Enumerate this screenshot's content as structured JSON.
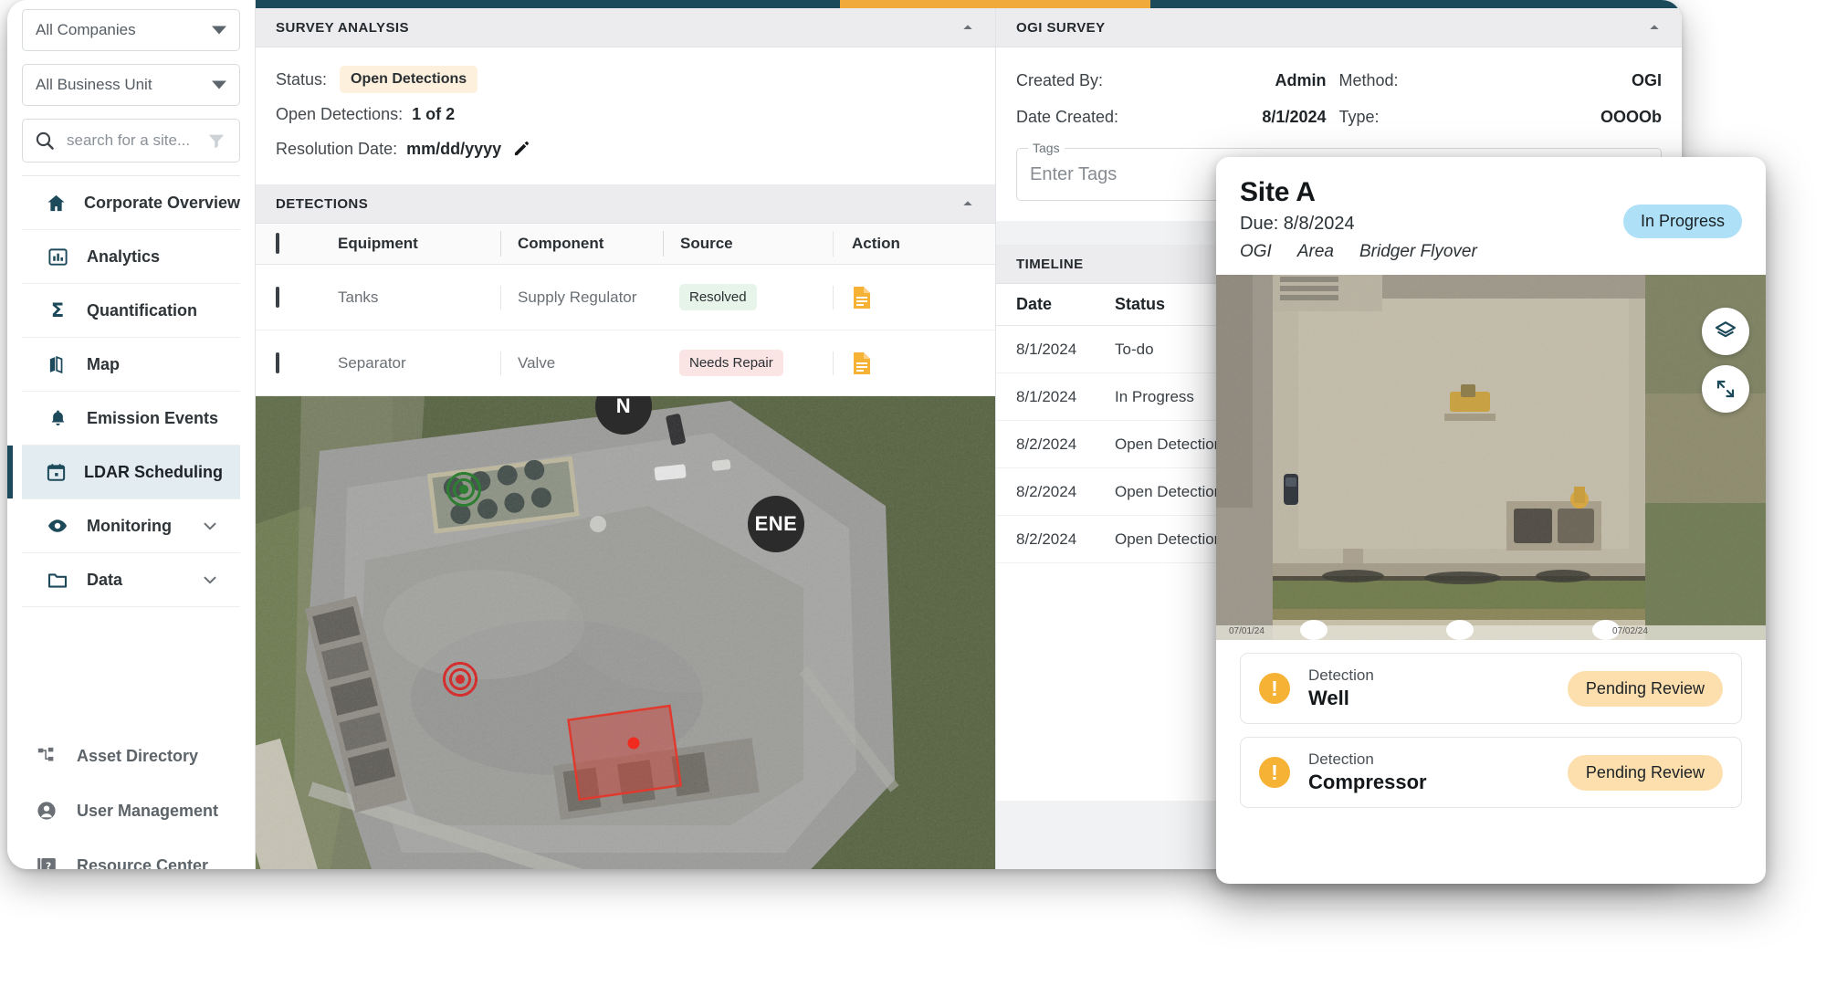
{
  "topbar": {
    "accent_dark": "#1d4a5b",
    "accent_orange": "#f0a93b"
  },
  "sidebar": {
    "company_filter": {
      "value": "All Companies",
      "icon": "chevron-down-icon"
    },
    "business_unit_filter": {
      "value": "All Business Unit",
      "icon": "chevron-down-icon"
    },
    "search": {
      "placeholder": "search for a site...",
      "icon": "search-icon",
      "filter_icon": "funnel-icon"
    },
    "items": [
      {
        "label": "Corporate Overview",
        "icon": "home-icon",
        "active": false,
        "expandable": false
      },
      {
        "label": "Analytics",
        "icon": "bar-chart-icon",
        "active": false,
        "expandable": false
      },
      {
        "label": "Quantification",
        "icon": "sigma-icon",
        "active": false,
        "expandable": false
      },
      {
        "label": "Map",
        "icon": "map-icon",
        "active": false,
        "expandable": false
      },
      {
        "label": "Emission Events",
        "icon": "bell-icon",
        "active": false,
        "expandable": false
      },
      {
        "label": "LDAR Scheduling",
        "icon": "calendar-icon",
        "active": true,
        "expandable": false
      },
      {
        "label": "Monitoring",
        "icon": "eye-icon",
        "active": false,
        "expandable": true
      },
      {
        "label": "Data",
        "icon": "folder-icon",
        "active": false,
        "expandable": true
      }
    ],
    "bottom_items": [
      {
        "label": "Asset Directory",
        "icon": "sitemap-icon"
      },
      {
        "label": "User Management",
        "icon": "user-circle-icon"
      },
      {
        "label": "Resource Center",
        "icon": "help-book-icon"
      }
    ]
  },
  "survey_analysis": {
    "title": "SURVEY ANALYSIS",
    "collapse_icon": "chevron-up-icon",
    "status_label": "Status:",
    "status_value": "Open Detections",
    "open_detections_label": "Open Detections:",
    "open_detections_value": "1 of 2",
    "resolution_label": "Resolution Date:",
    "resolution_value": "mm/dd/yyyy",
    "edit_icon": "pencil-icon"
  },
  "detections": {
    "title": "DETECTIONS",
    "collapse_icon": "chevron-up-icon",
    "columns": [
      "Equipment",
      "Component",
      "Source",
      "Action"
    ],
    "rows": [
      {
        "equipment": "Tanks",
        "component": "Supply Regulator",
        "source": "Resolved",
        "source_kind": "resolved",
        "action_icon": "document-note-icon"
      },
      {
        "equipment": "Separator",
        "component": "Valve",
        "source": "Needs Repair",
        "source_kind": "repair",
        "action_icon": "document-note-icon"
      }
    ]
  },
  "map": {
    "compass_markers": [
      {
        "label": "N"
      },
      {
        "label": "ENE"
      }
    ],
    "detection_markers": [
      {
        "kind": "green-target"
      },
      {
        "kind": "red-target"
      }
    ],
    "leak_polygon": {
      "color": "#e03a2f"
    }
  },
  "ogi_survey": {
    "title": "OGI SURVEY",
    "collapse_icon": "chevron-up-icon",
    "fields": [
      {
        "key": "Created By:",
        "value": "Admin"
      },
      {
        "key": "Method:",
        "value": "OGI"
      },
      {
        "key": "Date Created:",
        "value": "8/1/2024"
      },
      {
        "key": "Type:",
        "value": "OOOOb"
      }
    ],
    "tags": {
      "legend": "Tags",
      "placeholder": "Enter Tags"
    }
  },
  "timeline": {
    "title": "TIMELINE",
    "columns": [
      "Date",
      "Status"
    ],
    "rows": [
      {
        "date": "8/1/2024",
        "status": "In Progress"
      },
      {
        "date": "8/1/2024",
        "status": "To-do"
      },
      {
        "date": "8/1/2024",
        "status": "In Progress"
      },
      {
        "date": "8/2/2024",
        "status": "Open Detections"
      },
      {
        "date": "8/2/2024",
        "status": "Open Detections"
      },
      {
        "date": "8/2/2024",
        "status": "Open Detections"
      }
    ]
  },
  "site_card": {
    "title": "Site A",
    "due": "Due: 8/8/2024",
    "badge": "In Progress",
    "meta": [
      "OGI",
      "Area",
      "Bridger Flyover"
    ],
    "layers_icon": "layers-icon",
    "expand_icon": "expand-icon",
    "detections": [
      {
        "sub": "Detection",
        "name": "Well",
        "status": "Pending Review",
        "icon": "alert-icon"
      },
      {
        "sub": "Detection",
        "name": "Compressor",
        "status": "Pending Review",
        "icon": "alert-icon"
      }
    ]
  }
}
